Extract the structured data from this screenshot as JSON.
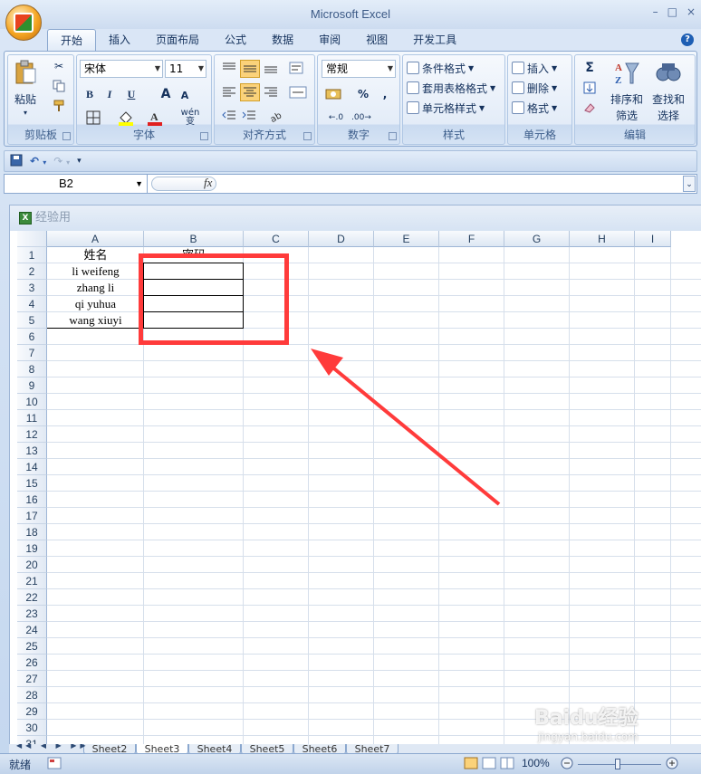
{
  "window": {
    "title": "Microsoft Excel",
    "controls": [
      "–",
      "□",
      "×"
    ]
  },
  "tabs": [
    "开始",
    "插入",
    "页面布局",
    "公式",
    "数据",
    "审阅",
    "视图",
    "开发工具"
  ],
  "active_tab": "开始",
  "ribbon": {
    "clipboard": {
      "label": "剪贴板",
      "paste": "粘贴"
    },
    "font": {
      "label": "字体",
      "font_name": "宋体",
      "font_size": "11",
      "bold": "B",
      "italic": "I",
      "underline": "U",
      "grow": "A",
      "shrink": "A",
      "phonetic": "wén 变"
    },
    "alignment": {
      "label": "对齐方式"
    },
    "number": {
      "label": "数字",
      "format": "常规",
      "percent": "%",
      "comma": ","
    },
    "styles": {
      "label": "样式",
      "conditional": "条件格式",
      "table": "套用表格格式",
      "cell_styles": "单元格样式"
    },
    "cells": {
      "label": "单元格",
      "insert": "插入",
      "delete": "删除",
      "format": "格式"
    },
    "editing": {
      "label": "编辑",
      "sort": "排序和",
      "sort2": "筛选",
      "find": "查找和",
      "find2": "选择",
      "sigma": "Σ"
    }
  },
  "formula_bar": {
    "name_box": "B2",
    "fx": "fx",
    "content": ""
  },
  "workbook": {
    "title": "经验用"
  },
  "columns": [
    "A",
    "B",
    "C",
    "D",
    "E",
    "F",
    "G",
    "H",
    "I"
  ],
  "rows": [
    "1",
    "2",
    "3",
    "4",
    "5",
    "6",
    "7",
    "8",
    "9",
    "10",
    "11",
    "12",
    "13",
    "14",
    "15",
    "16",
    "17",
    "18",
    "19",
    "20",
    "21",
    "22",
    "23",
    "24",
    "25",
    "26",
    "27",
    "28",
    "29",
    "30",
    "31"
  ],
  "cells": {
    "A1": "姓名",
    "B1": "密码",
    "A2": "li weifeng",
    "A3": "zhang li",
    "A4": "qi yuhua",
    "A5": "wang xiuyi"
  },
  "sheet_tabs": [
    "Sheet2",
    "Sheet3",
    "Sheet4",
    "Sheet5",
    "Sheet6",
    "Sheet7"
  ],
  "active_sheet": "Sheet3",
  "status": {
    "text": "就绪",
    "zoom": "100%"
  },
  "watermark": {
    "brand": "Baidu经验",
    "url": "jingyan.baidu.com"
  },
  "colors": {
    "highlight": "#ff3b3b",
    "ribbon_border": "#8ba8cf"
  }
}
